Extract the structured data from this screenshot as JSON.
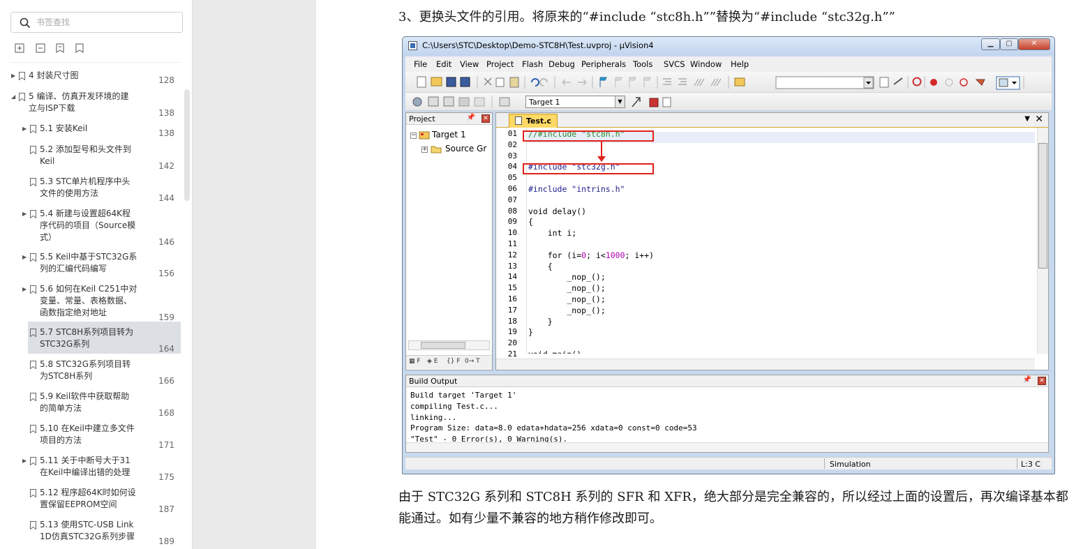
{
  "sidebar": {
    "search_placeholder": "书签查找",
    "bookmarks": [
      {
        "label": "4  封装尺寸图",
        "page": "128",
        "level": 0,
        "expandable": true
      },
      {
        "label": "5  编译、仿真开发环境的建立与ISP下载",
        "page": "138",
        "level": 0,
        "expanded": true
      },
      {
        "label": "5.1  安装Keil",
        "page": "138",
        "level": 1,
        "expandable": true
      },
      {
        "label": "5.2  添加型号和头文件到Keil",
        "page": "142",
        "level": 1
      },
      {
        "label": "5.3  STC单片机程序中头文件的使用方法",
        "page": "144",
        "level": 1
      },
      {
        "label": "5.4  新建与设置超64K程序代码的项目（Source模式）",
        "page": "146",
        "level": 1,
        "expandable": true
      },
      {
        "label": "5.5  Keil中基于STC32G系列的汇编代码编写",
        "page": "156",
        "level": 1,
        "expandable": true
      },
      {
        "label": "5.6  如何在Keil C251中对变量、常量、表格数据、函数指定绝对地址",
        "page": "159",
        "level": 1,
        "expandable": true
      },
      {
        "label": "5.7  STC8H系列项目转为STC32G系列",
        "page": "164",
        "level": 1,
        "active": true
      },
      {
        "label": "5.8  STC32G系列项目转为STC8H系列",
        "page": "166",
        "level": 1
      },
      {
        "label": "5.9  Keil软件中获取帮助的简单方法",
        "page": "168",
        "level": 1
      },
      {
        "label": "5.10  在Keil中建立多文件项目的方法",
        "page": "171",
        "level": 1
      },
      {
        "label": "5.11  关于中断号大于31在Keil中编译出错的处理",
        "page": "175",
        "level": 1,
        "expandable": true
      },
      {
        "label": "5.12  程序超64K时如何设置保留EEPROM空间",
        "page": "187",
        "level": 1
      },
      {
        "label": "5.13  使用STC-USB Link 1D仿真STC32G系列步骤",
        "page": "189",
        "level": 1
      }
    ]
  },
  "doc": {
    "step_text": "3、更换头文件的引用。将原来的“#include “stc8h.h””替换为“#include “stc32g.h””",
    "paragraph": "由于 STC32G 系列和 STC8H 系列的 SFR 和 XFR，绝大部分是完全兼容的，所以经过上面的设置后，再次编译基本都能通过。如有少量不兼容的地方稍作修改即可。"
  },
  "uvision": {
    "title": "C:\\Users\\STC\\Desktop\\Demo-STC8H\\Test.uvproj - µVision4",
    "menu": [
      "File",
      "Edit",
      "View",
      "Project",
      "Flash",
      "Debug",
      "Peripherals",
      "Tools",
      "SVCS",
      "Window",
      "Help"
    ],
    "target_select": "Target 1",
    "project_pane_title": "Project",
    "tree": {
      "root": "Target 1",
      "child": "Source Gr"
    },
    "editor_tab": "Test.c",
    "line_numbers": [
      "01",
      "02",
      "03",
      "04",
      "05",
      "06",
      "07",
      "08",
      "09",
      "10",
      "11",
      "12",
      "13",
      "14",
      "15",
      "16",
      "17",
      "18",
      "19",
      "20",
      "21"
    ],
    "code": {
      "l01": "//#include \"stc8h.h\"",
      "l04": "#include \"stc32g.h\"",
      "l06": "#include \"intrins.h\"",
      "l08": "void delay()",
      "l09": "{",
      "l10": "    int i;",
      "l12_a": "    for (i=",
      "l12_b": "0",
      "l12_c": "; i<",
      "l12_d": "1000",
      "l12_e": "; i++)",
      "l13": "    {",
      "l14": "        _nop_();",
      "l15": "        _nop_();",
      "l16": "        _nop_();",
      "l17": "        _nop_();",
      "l18": "    }",
      "l19": "}",
      "l21": "void main()"
    },
    "build_title": "Build Output",
    "build_lines": [
      "Build target 'Target 1'",
      "compiling Test.c...",
      "linking...",
      "Program Size: data=8.0 edata+hdata=256 xdata=0 const=0 code=53",
      "\"Test\" - 0 Error(s), 0 Warning(s)."
    ],
    "status_mode": "Simulation",
    "status_pos": "L:3 C"
  },
  "colors": {
    "highlight_red": "#e0201a",
    "active_bookmark": "#dcdfe4",
    "tab_yellow": "#ffd966"
  }
}
